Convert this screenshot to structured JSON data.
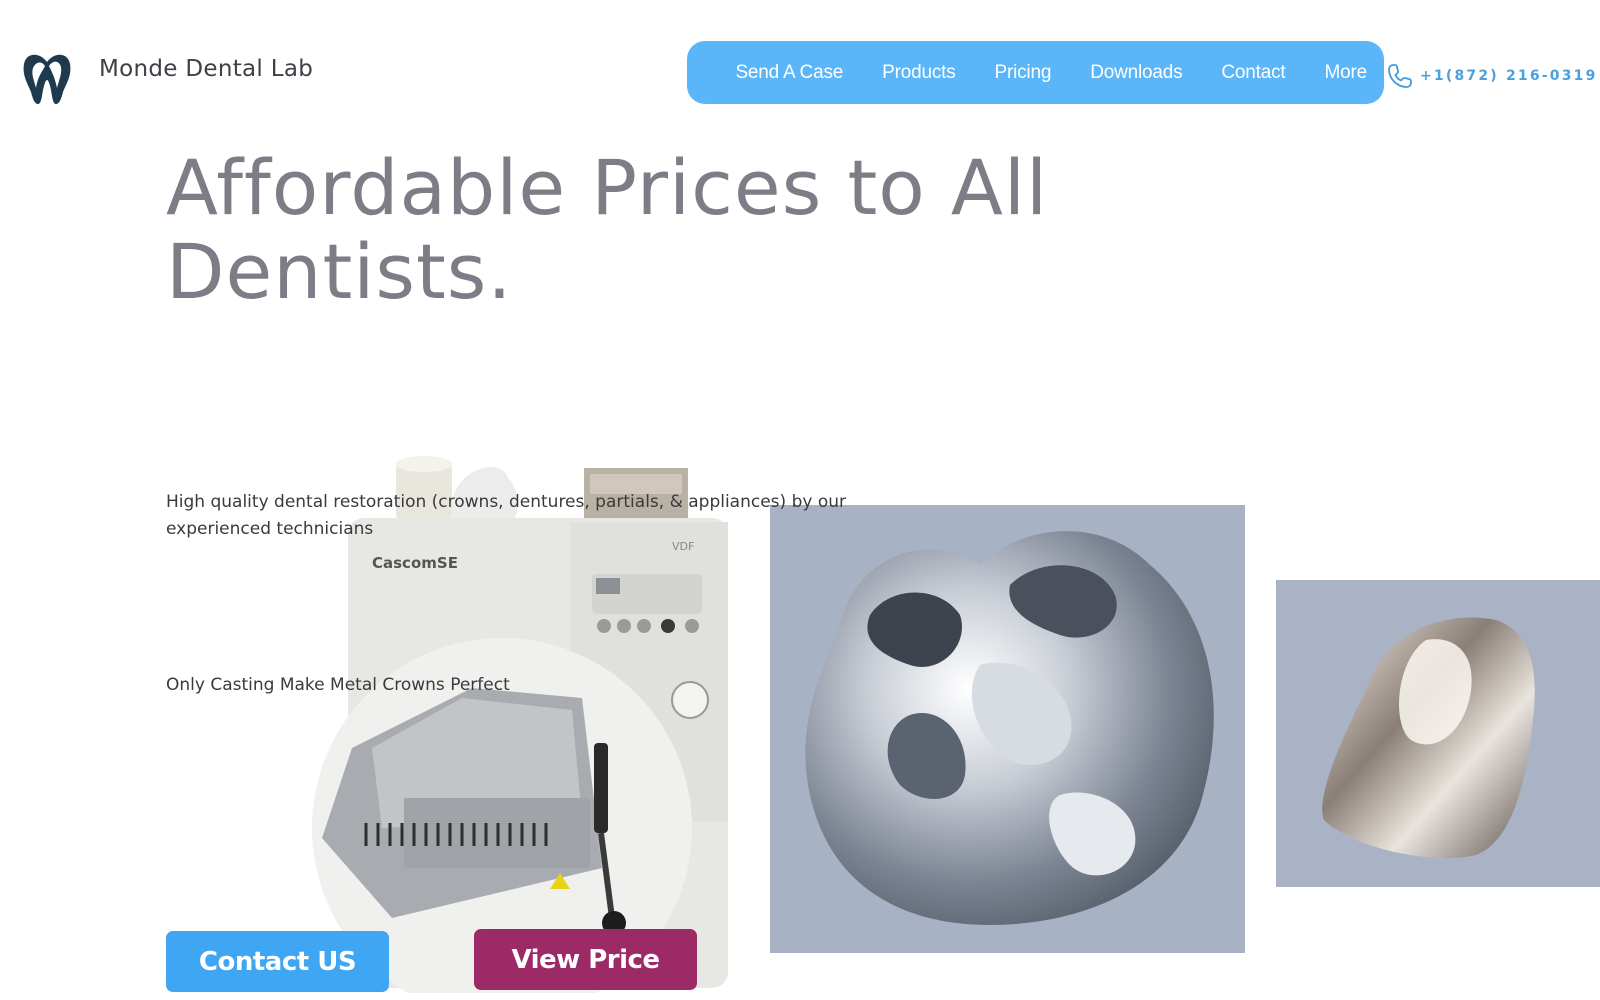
{
  "brand": {
    "name": "Monde Dental Lab",
    "logo_icon": "tooth-icon",
    "logo_color": "#1f3a4d"
  },
  "nav": {
    "items": [
      "Send A Case",
      "Products",
      "Pricing",
      "Downloads",
      "Contact",
      "More"
    ],
    "background": "#5ab6f8"
  },
  "phone": {
    "icon": "phone-icon",
    "number": "+1(872) 216-0319",
    "color": "#4a9fdf"
  },
  "hero": {
    "title": "Affordable Prices to All Dentists.",
    "description": "High quality dental restoration (crowns, dentures, partials, & appliances) by our experienced technicians",
    "subtitle": "Only Casting Make Metal Crowns Perfect"
  },
  "images": {
    "machine": {
      "brand": "CascomSE",
      "badge": "VDF"
    },
    "crown": "metal-crown-photo",
    "tooth": "metal-tooth-crown-photo"
  },
  "buttons": {
    "contact": {
      "label": "Contact US",
      "color": "#3fa6f3"
    },
    "price": {
      "label": "View Price",
      "color": "#9b2a66"
    }
  }
}
